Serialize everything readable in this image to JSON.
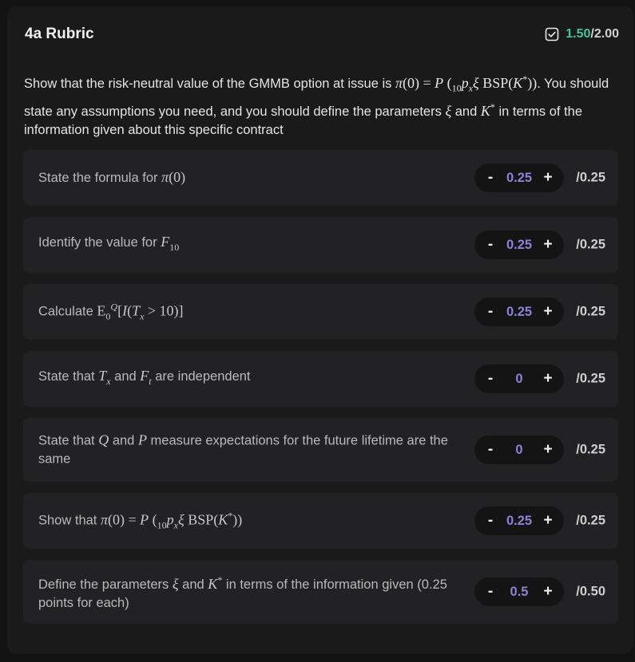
{
  "header": {
    "title": "4a Rubric",
    "score_earned": "1.50",
    "score_total": "/2.00",
    "check_icon": "checkbox-checked-icon",
    "colors": {
      "earned": "#3ec79a",
      "value": "#8c83d6"
    }
  },
  "prompt": {
    "part1": "Show that the risk-neutral value of the GMMB option at issue is",
    "part2": ". You should state any assumptions you need, and you should define the parameters",
    "part3": "and",
    "part4": "in terms of the information given about this specific contract"
  },
  "items": [
    {
      "label_pre": "State the formula for",
      "label_post": "",
      "value": "0.25",
      "max": "/0.25",
      "minus": "-",
      "plus": "+"
    },
    {
      "label_pre": "Identify the value for",
      "label_post": "",
      "value": "0.25",
      "max": "/0.25",
      "minus": "-",
      "plus": "+"
    },
    {
      "label_pre": "Calculate",
      "label_post": "",
      "value": "0.25",
      "max": "/0.25",
      "minus": "-",
      "plus": "+"
    },
    {
      "label_pre": "State that",
      "label_mid": "and",
      "label_post": "are independent",
      "value": "0",
      "max": "/0.25",
      "minus": "-",
      "plus": "+"
    },
    {
      "label_pre": "State that",
      "label_mid": "and",
      "label_post": "measure expectations for the future lifetime are the same",
      "value": "0",
      "max": "/0.25",
      "minus": "-",
      "plus": "+"
    },
    {
      "label_pre": "Show that",
      "label_post": "",
      "value": "0.25",
      "max": "/0.25",
      "minus": "-",
      "plus": "+"
    },
    {
      "label_pre": "Define the parameters",
      "label_mid": "and",
      "label_post": "in terms of the information given (0.25 points for each)",
      "value": "0.5",
      "max": "/0.50",
      "minus": "-",
      "plus": "+"
    }
  ]
}
